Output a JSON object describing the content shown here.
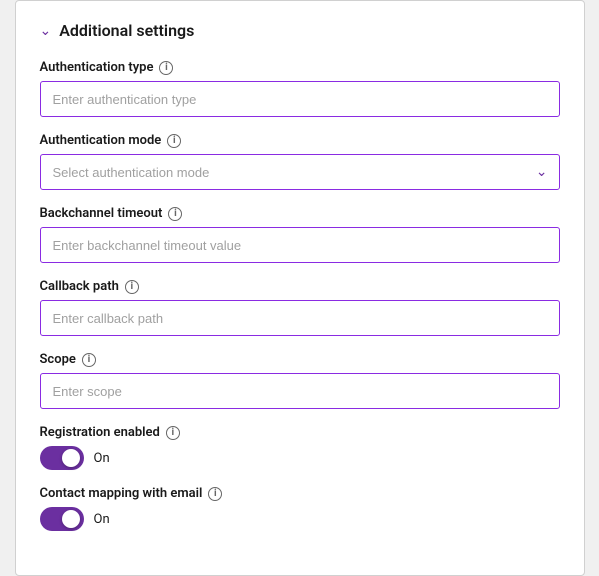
{
  "section": {
    "title": "Additional settings"
  },
  "fields": {
    "auth_type": {
      "label": "Authentication type",
      "placeholder": "Enter authentication type"
    },
    "auth_mode": {
      "label": "Authentication mode",
      "placeholder": "Select authentication mode",
      "options": [
        "Select authentication mode"
      ]
    },
    "backchannel_timeout": {
      "label": "Backchannel timeout",
      "placeholder": "Enter backchannel timeout value"
    },
    "callback_path": {
      "label": "Callback path",
      "placeholder": "Enter callback path"
    },
    "scope": {
      "label": "Scope",
      "placeholder": "Enter scope"
    },
    "registration_enabled": {
      "label": "Registration enabled",
      "toggle_label": "On",
      "enabled": true
    },
    "contact_mapping": {
      "label": "Contact mapping with email",
      "toggle_label": "On",
      "enabled": true
    }
  },
  "icons": {
    "info": "i",
    "chevron_down": "∨",
    "chevron_left": "∨"
  }
}
